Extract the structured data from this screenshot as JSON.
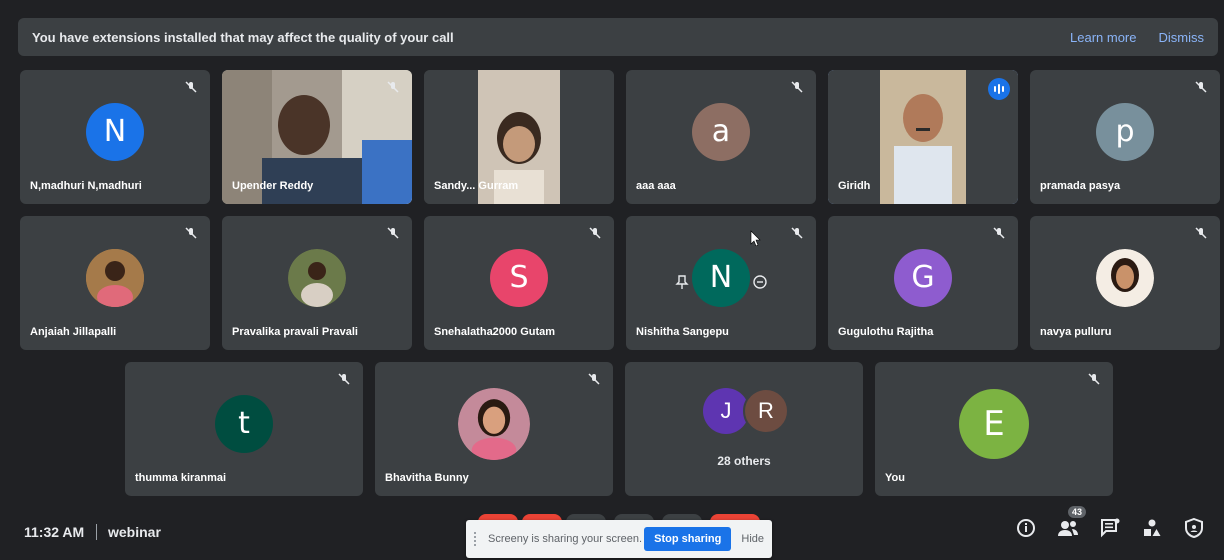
{
  "banner": {
    "text": "You have extensions installed that may affect the quality of your call",
    "learn_more": "Learn more",
    "dismiss": "Dismiss"
  },
  "tiles": [
    {
      "name": "N,madhuri N,madhuri",
      "initial": "N",
      "color": "#1a73e8"
    },
    {
      "name": "Upender Reddy"
    },
    {
      "name": "Sandy... Gurram"
    },
    {
      "name": "aaa aaa",
      "initial": "a",
      "color": "#8d6e63"
    },
    {
      "name": "Giridh"
    },
    {
      "name": "pramada pasya",
      "initial": "p",
      "color": "#78909c"
    },
    {
      "name": "Anjaiah Jillapalli"
    },
    {
      "name": "Pravalika pravali Pravali"
    },
    {
      "name": "Snehalatha2000 Gutam",
      "initial": "S",
      "color": "#e8456b"
    },
    {
      "name": "Nishitha Sangepu",
      "initial": "N",
      "color": "#00695c"
    },
    {
      "name": "Gugulothu Rajitha",
      "initial": "G",
      "color": "#8e5ccf"
    },
    {
      "name": "navya pulluru"
    },
    {
      "name": "thumma kiranmai",
      "initial": "t",
      "color": "#004d40"
    },
    {
      "name": "Bhavitha Bunny"
    },
    {
      "name": "28 others",
      "initial_a": "J",
      "color_a": "#5e35b1",
      "initial_b": "R",
      "color_b": "#6d4c41"
    },
    {
      "name": "You",
      "initial": "E",
      "color": "#7cb342"
    }
  ],
  "bottom": {
    "time": "11:32 AM",
    "meeting_name": "webinar",
    "people_count": "43"
  },
  "share": {
    "text": "Screeny is sharing your screen.",
    "stop": "Stop sharing",
    "hide": "Hide"
  }
}
